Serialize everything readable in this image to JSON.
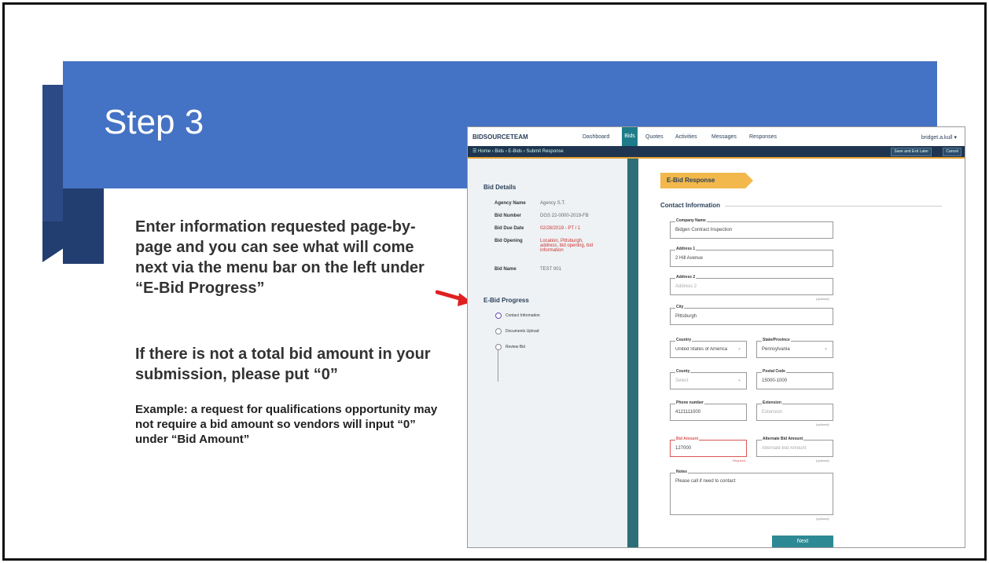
{
  "slide": {
    "title": "Step 3",
    "paragraph1": "Enter information requested page-by-page and you can see what will come next via the menu bar on the left under “E-Bid Progress”",
    "paragraph2": "If there is not a total bid amount in your submission, please put “0”",
    "paragraph3": "Example: a request for qualifications opportunity may not require a bid amount so vendors will input “0” under “Bid Amount”"
  },
  "colors": {
    "banner": "#4472c4",
    "arrow": "#e02020",
    "nav_accent": "#1e7c8a",
    "tag": "#f2b84b"
  },
  "screenshot": {
    "app_logo": "BIDSOURCETEAM",
    "nav": {
      "dashboard": "Dashboard",
      "bids": "Bids",
      "quotes": "Quotes",
      "activities": "Activities",
      "messages": "Messages",
      "responses": "Responses"
    },
    "user_menu": "bridget.a.kull ▾",
    "breadcrumb": "☰ Home › Bids › E-Bids › Submit Response",
    "top_buttons": {
      "save_exit": "Save and Exit Later",
      "cancel": "Cancel"
    },
    "bid_details": {
      "heading": "Bid Details",
      "rows": [
        {
          "label": "Agency Name",
          "value": "Agency S.T."
        },
        {
          "label": "Bid Number",
          "value": "DGS 22-0000-2019-FB"
        },
        {
          "label": "Bid Due Date",
          "value": "02/28/2019 - PT / 1"
        },
        {
          "label": "Bid Opening",
          "value": "Location, Pittsburgh, address, bid opening, bid information"
        },
        {
          "label": "Bid Name",
          "value": "TEST 001"
        }
      ]
    },
    "progress": {
      "heading": "E-Bid Progress",
      "items": [
        "Contact Information",
        "Documents Upload",
        "Review Bid"
      ]
    },
    "form": {
      "tag": "E-Bid Response",
      "section": "Contact Information",
      "company_name": {
        "label": "Company Name",
        "value": "Bidgen Contract Inspection"
      },
      "address1": {
        "label": "Address 1",
        "value": "2 Hill Avenue"
      },
      "address2": {
        "label": "Address 2",
        "value": "Address 2"
      },
      "city": {
        "label": "City",
        "value": "Pittsburgh"
      },
      "country": {
        "label": "Country",
        "value": "United States of America"
      },
      "state": {
        "label": "State/Province",
        "value": "Pennsylvania"
      },
      "county": {
        "label": "County",
        "value": "Select"
      },
      "postal": {
        "label": "Postal Code",
        "value": "15000-1000"
      },
      "phone": {
        "label": "Phone number",
        "value": "4121111000"
      },
      "extension": {
        "label": "Extension",
        "value": "Extension"
      },
      "bid_amount": {
        "label": "Bid Amount",
        "value": "127000"
      },
      "alt_bid": {
        "label": "Alternate Bid Amount",
        "value": "Alternate Bid Amount"
      },
      "notes": {
        "label": "Notes",
        "value": "Please call if need to contact"
      },
      "optional": "(optional)",
      "required": "Required",
      "next": "Next"
    }
  }
}
